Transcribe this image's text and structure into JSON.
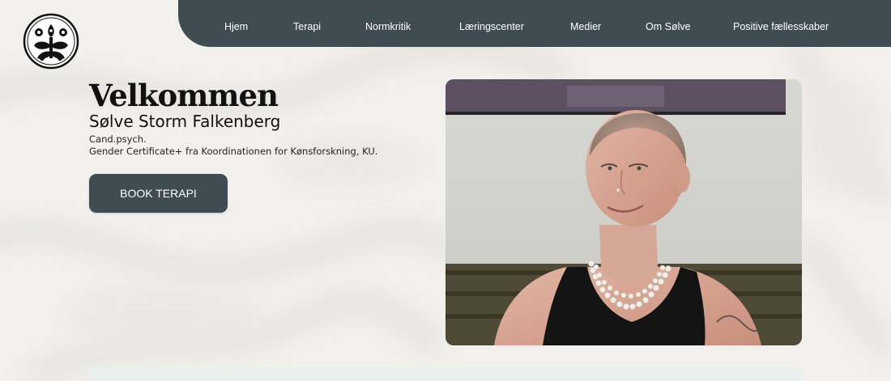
{
  "logo": {
    "icon": "ornate-tree-emblem-icon"
  },
  "nav": {
    "items": [
      {
        "label": "Hjem"
      },
      {
        "label": "Terapi"
      },
      {
        "label": "Normkritik"
      },
      {
        "label": "Læringscenter"
      },
      {
        "label": "Medier"
      },
      {
        "label": "Om Sølve"
      },
      {
        "label": "Positive fællesskaber"
      }
    ]
  },
  "hero": {
    "title": "Velkommen",
    "name": "Sølve Storm Falkenberg",
    "credential_1": "Cand.psych.",
    "credential_2": "Gender Certificate+ fra Koordinationen for Kønsforskning, KU.",
    "cta_label": "BOOK TERAPI"
  },
  "photo": {
    "subject": "portrait-photo"
  },
  "colors": {
    "nav_bg": "#3f4d52",
    "button_bg": "#3f4d52",
    "page_bg": "#f2f1ee",
    "text": "#111111"
  }
}
